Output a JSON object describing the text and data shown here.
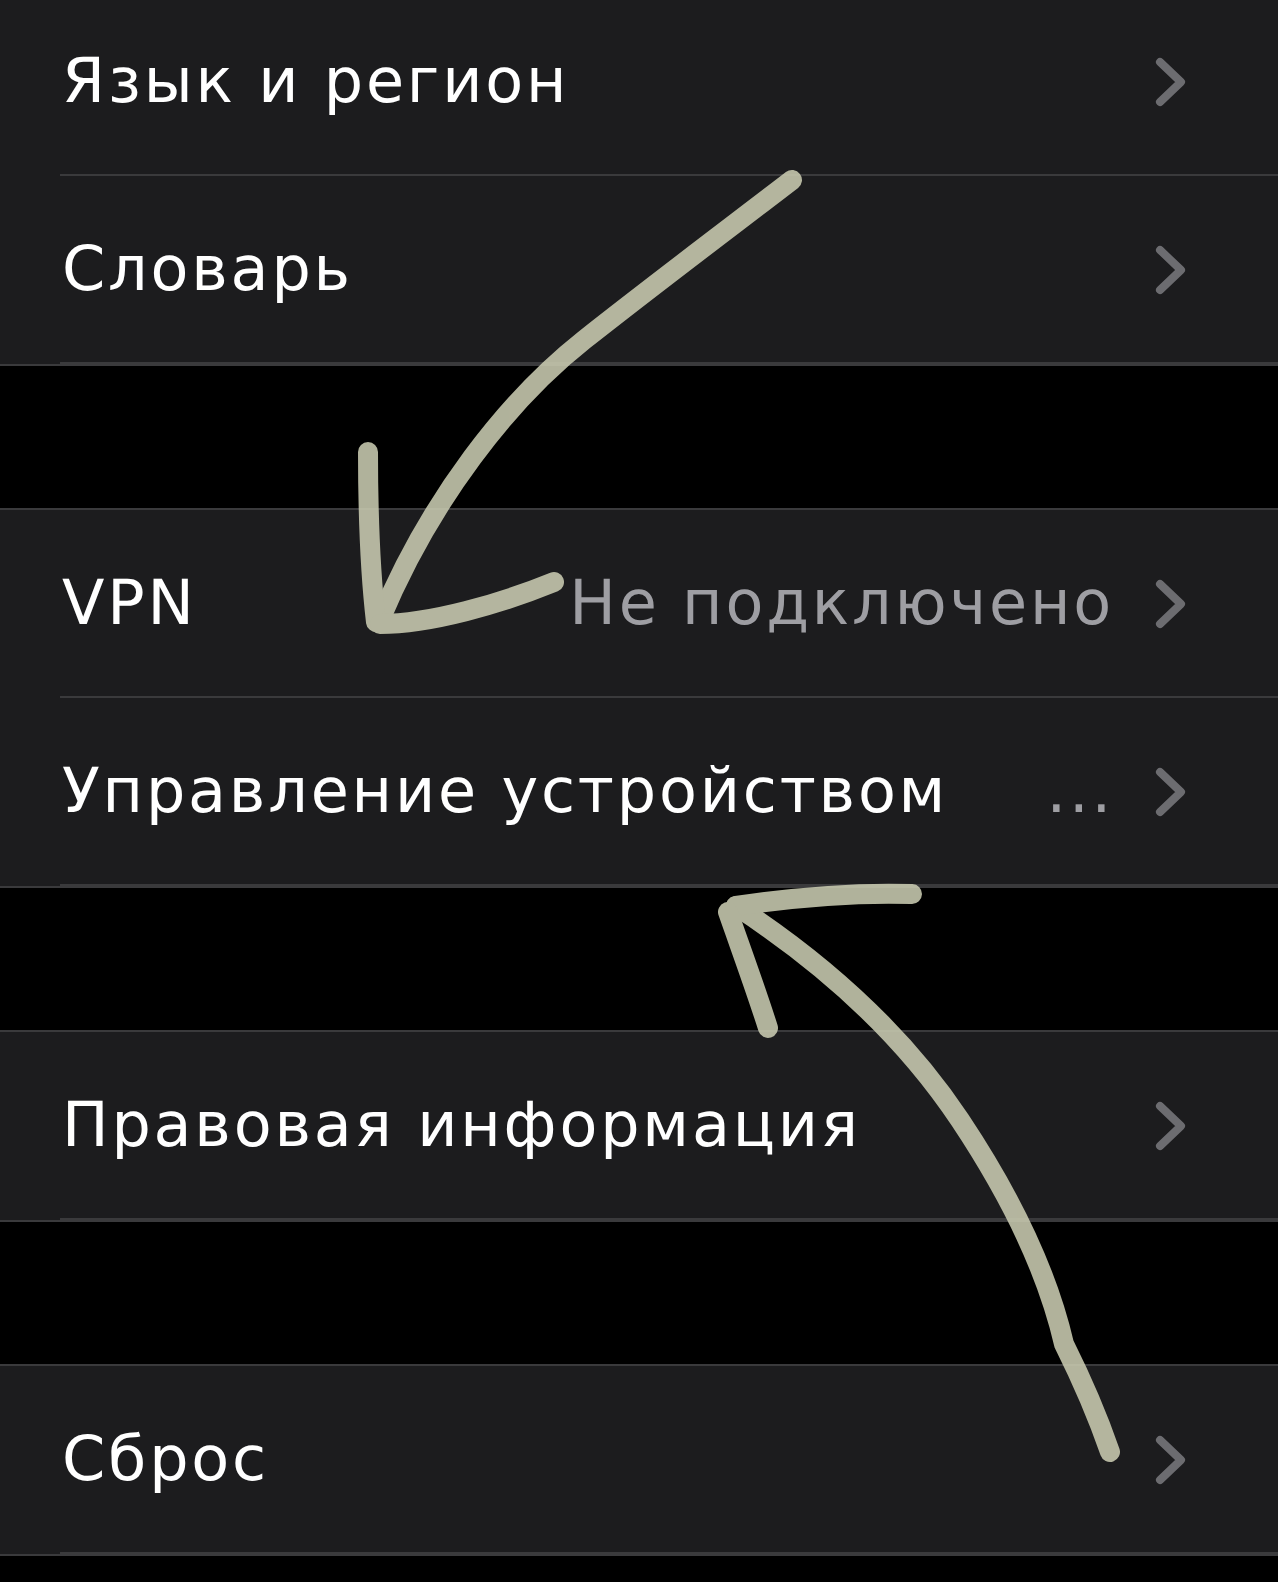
{
  "sections": [
    {
      "rows": [
        {
          "label": "Язык и регион"
        },
        {
          "label": "Словарь"
        }
      ]
    },
    {
      "rows": [
        {
          "label": "VPN",
          "value": "Не подключено"
        },
        {
          "label": "Управление устройством",
          "value": "..."
        }
      ]
    },
    {
      "rows": [
        {
          "label": "Правовая информация"
        }
      ]
    },
    {
      "rows": [
        {
          "label": "Сброс"
        }
      ]
    }
  ]
}
